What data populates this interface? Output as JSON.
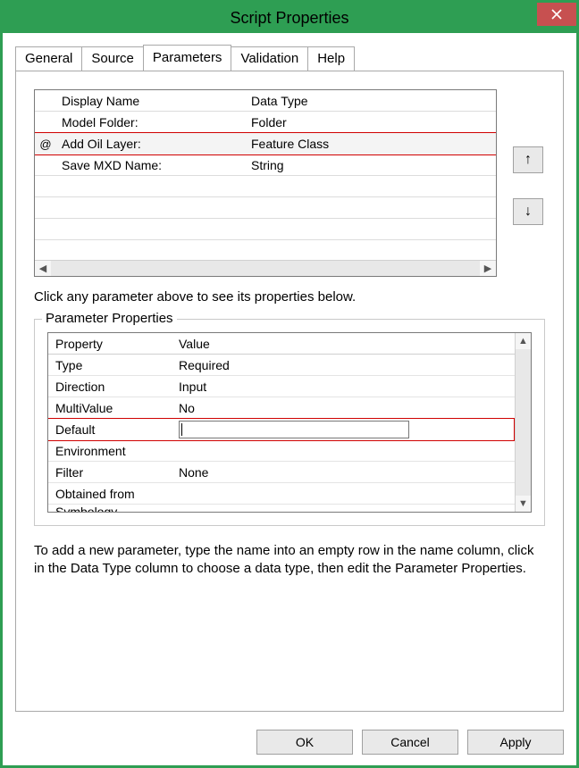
{
  "window": {
    "title": "Script Properties"
  },
  "tabs": {
    "items": [
      "General",
      "Source",
      "Parameters",
      "Validation",
      "Help"
    ],
    "active": 2
  },
  "param_table": {
    "headers": {
      "name": "Display Name",
      "type": "Data Type"
    },
    "rows": [
      {
        "indicator": "",
        "name": "Model Folder:",
        "type": "Folder"
      },
      {
        "indicator": "@",
        "name": "Add Oil Layer:",
        "type": "Feature Class",
        "selected": true
      },
      {
        "indicator": "",
        "name": "Save MXD Name:",
        "type": "String"
      }
    ]
  },
  "hint": "Click any parameter above to see its properties below.",
  "properties_box": {
    "legend": "Parameter Properties",
    "headers": {
      "key": "Property",
      "value": "Value"
    },
    "rows": [
      {
        "key": "Type",
        "value": "Required"
      },
      {
        "key": "Direction",
        "value": "Input"
      },
      {
        "key": "MultiValue",
        "value": "No"
      },
      {
        "key": "Default",
        "value": "",
        "editing": true
      },
      {
        "key": "Environment",
        "value": ""
      },
      {
        "key": "Filter",
        "value": "None"
      },
      {
        "key": "Obtained from",
        "value": ""
      },
      {
        "key": "Symbology",
        "value": ""
      }
    ]
  },
  "help_text": "To add a new parameter, type the name into an empty row in the name column, click in the Data Type column to choose a data type, then edit the Parameter Properties.",
  "buttons": {
    "ok": "OK",
    "cancel": "Cancel",
    "apply": "Apply"
  }
}
